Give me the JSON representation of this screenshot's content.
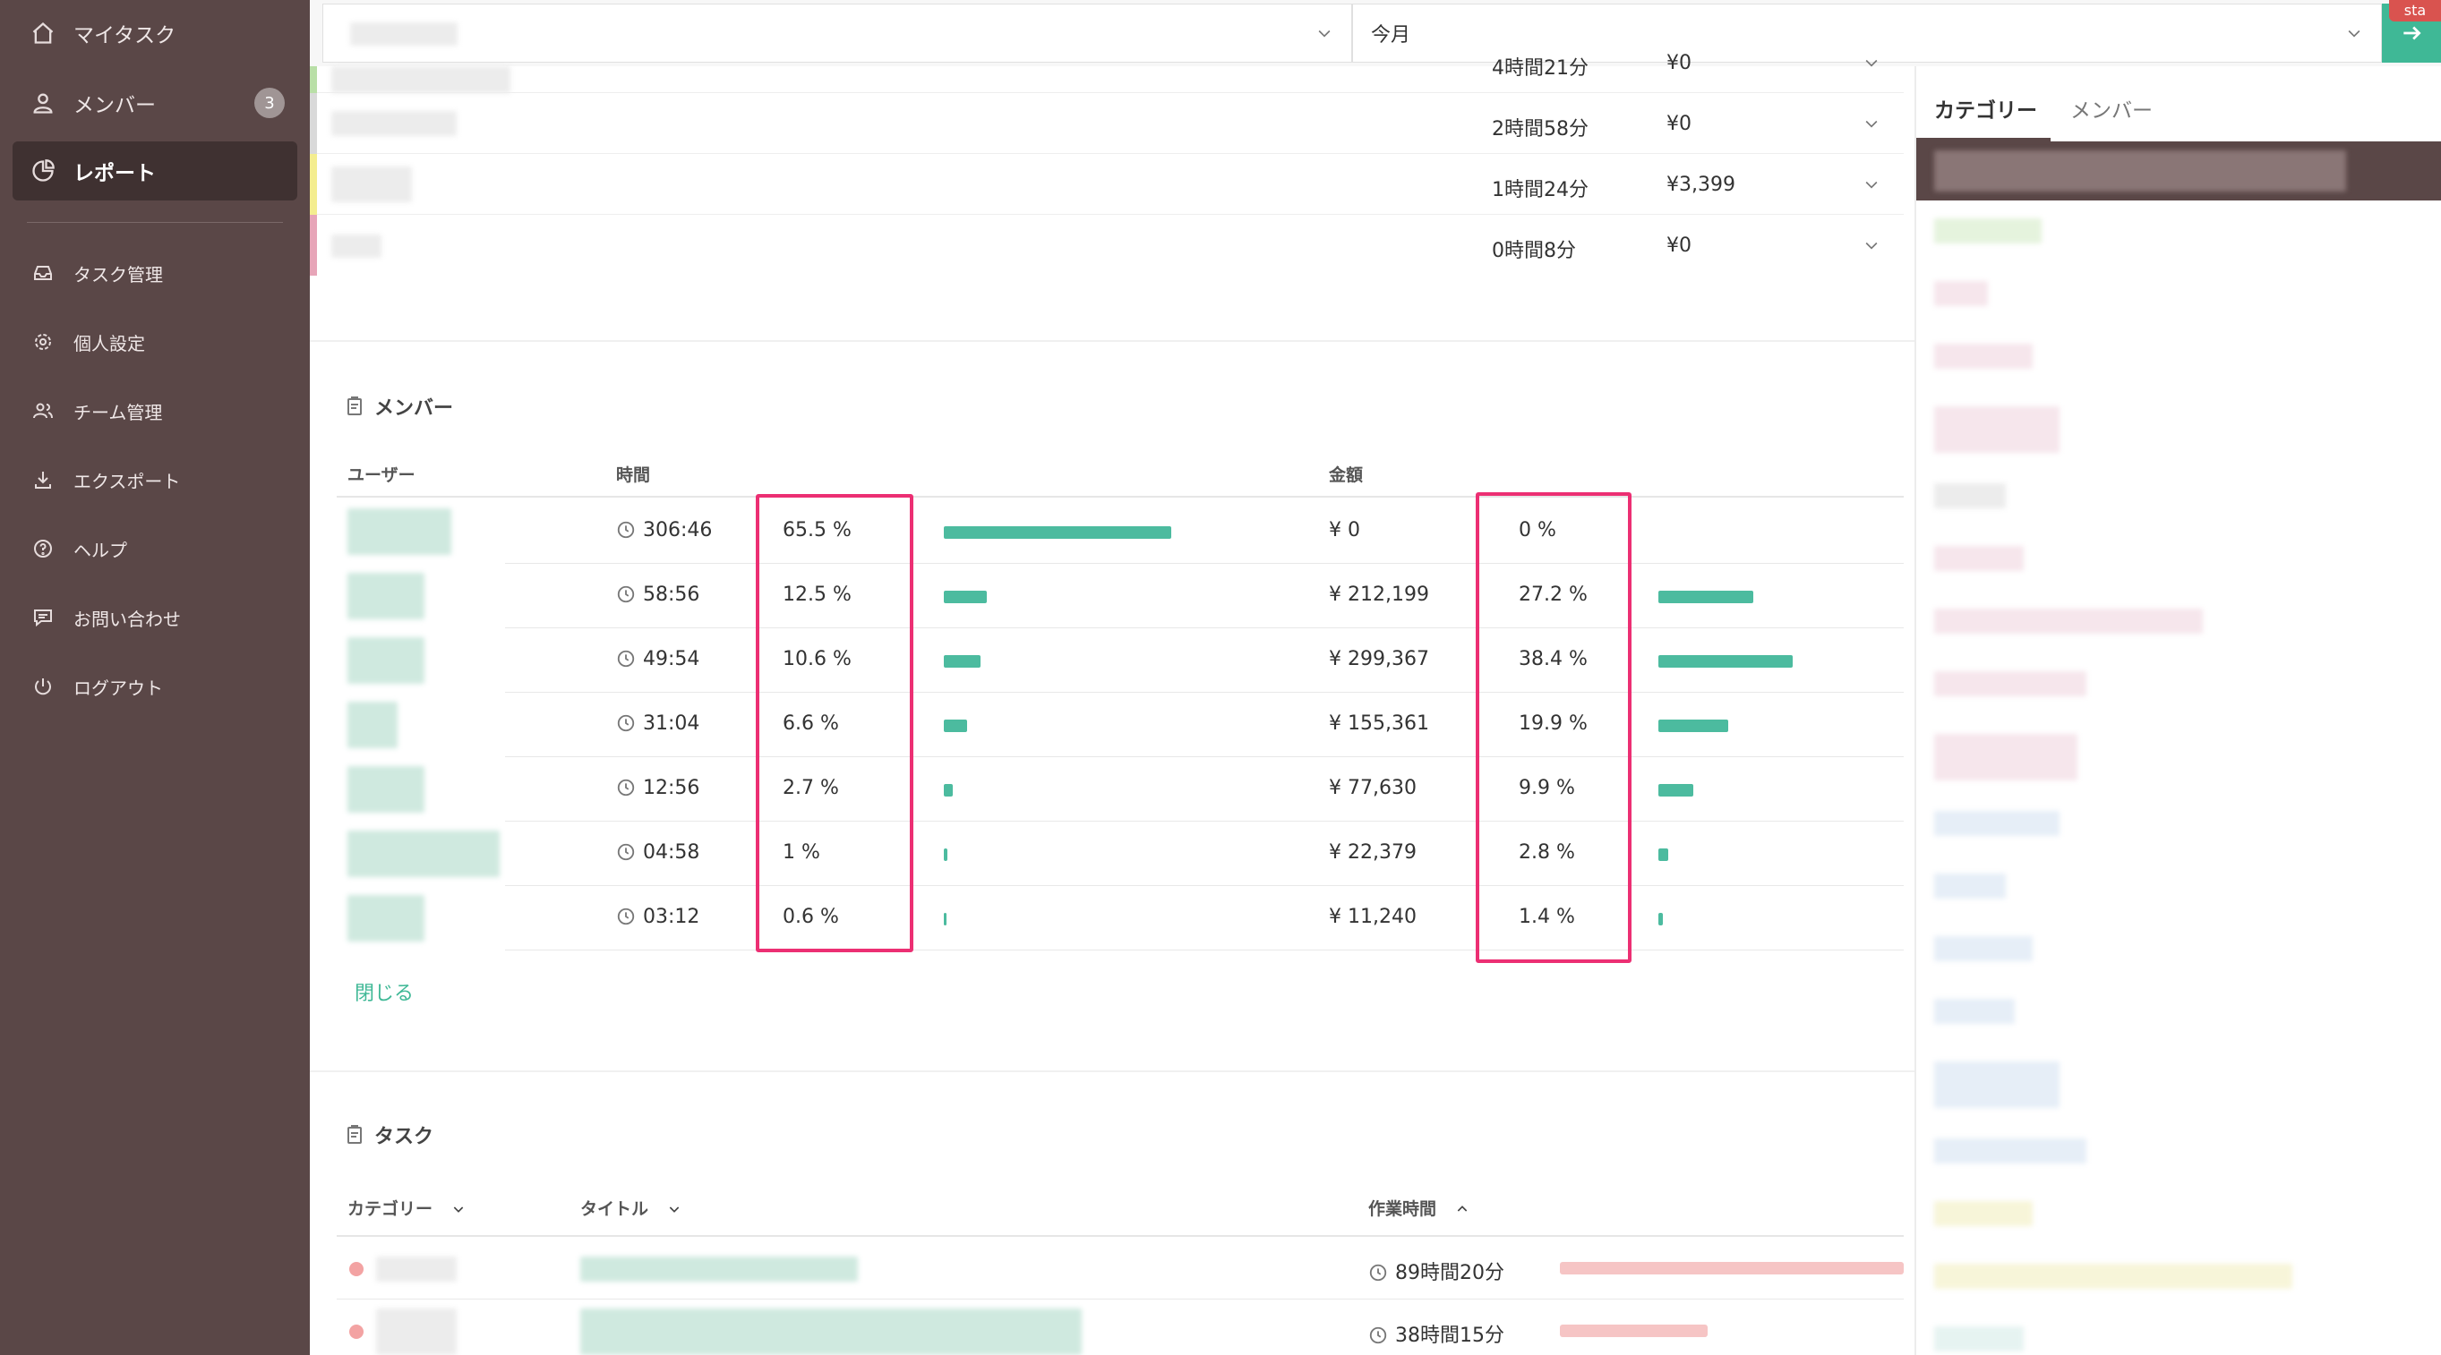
{
  "sidebar": {
    "items": [
      {
        "label": "マイタスク",
        "icon": "home-icon"
      },
      {
        "label": "メンバー",
        "icon": "person-icon",
        "badge": "3"
      },
      {
        "label": "レポート",
        "icon": "pie-chart-icon",
        "active": true
      },
      {
        "label": "タスク管理",
        "icon": "inbox-icon"
      },
      {
        "label": "個人設定",
        "icon": "gear-icon"
      },
      {
        "label": "チーム管理",
        "icon": "team-icon"
      },
      {
        "label": "エクスポート",
        "icon": "download-icon"
      },
      {
        "label": "ヘルプ",
        "icon": "help-icon"
      },
      {
        "label": "お問い合わせ",
        "icon": "chat-icon"
      },
      {
        "label": "ログアウト",
        "icon": "power-icon"
      }
    ]
  },
  "topbar": {
    "period_value": "今月",
    "corner_tag": "sta"
  },
  "categories": [
    {
      "time": "4時間21分",
      "amount": "¥0"
    },
    {
      "time": "2時間58分",
      "amount": "¥0"
    },
    {
      "time": "1時間24分",
      "amount": "¥3,399"
    },
    {
      "time": "0時間8分",
      "amount": "¥0"
    }
  ],
  "members_section": {
    "title": "メンバー",
    "headers": {
      "user": "ユーザー",
      "time": "時間",
      "amount": "金額"
    },
    "rows": [
      {
        "time": "306:46",
        "time_pct": "65.5 %",
        "time_pct_value": 65.5,
        "amount": "¥ 0",
        "amount_pct": "0 %",
        "amount_pct_value": 0
      },
      {
        "time": "58:56",
        "time_pct": "12.5 %",
        "time_pct_value": 12.5,
        "amount": "¥ 212,199",
        "amount_pct": "27.2 %",
        "amount_pct_value": 27.2
      },
      {
        "time": "49:54",
        "time_pct": "10.6 %",
        "time_pct_value": 10.6,
        "amount": "¥ 299,367",
        "amount_pct": "38.4 %",
        "amount_pct_value": 38.4
      },
      {
        "time": "31:04",
        "time_pct": "6.6 %",
        "time_pct_value": 6.6,
        "amount": "¥ 155,361",
        "amount_pct": "19.9 %",
        "amount_pct_value": 19.9
      },
      {
        "time": "12:56",
        "time_pct": "2.7 %",
        "time_pct_value": 2.7,
        "amount": "¥ 77,630",
        "amount_pct": "9.9 %",
        "amount_pct_value": 9.9
      },
      {
        "time": "04:58",
        "time_pct": "1 %",
        "time_pct_value": 1,
        "amount": "¥ 22,379",
        "amount_pct": "2.8 %",
        "amount_pct_value": 2.8
      },
      {
        "time": "03:12",
        "time_pct": "0.6 %",
        "time_pct_value": 0.6,
        "amount": "¥ 11,240",
        "amount_pct": "1.4 %",
        "amount_pct_value": 1.4
      }
    ],
    "close_label": "閉じる"
  },
  "tasks_section": {
    "title": "タスク",
    "headers": {
      "category": "カテゴリー",
      "title": "タイトル",
      "work_time": "作業時間"
    },
    "rows": [
      {
        "work_time": "89時間20分",
        "pct_value": 100
      },
      {
        "work_time": "38時間15分",
        "pct_value": 43
      }
    ]
  },
  "right_panel": {
    "tabs": [
      "カテゴリー",
      "メンバー"
    ],
    "active_tab": "カテゴリー"
  },
  "colors": {
    "sidebar_bg": "#5a4747",
    "accent_green": "#3fb896",
    "bar_green": "#4cbb9f",
    "highlight_pink": "#ec2f73",
    "task_bar_pink": "#f6c5c5"
  }
}
